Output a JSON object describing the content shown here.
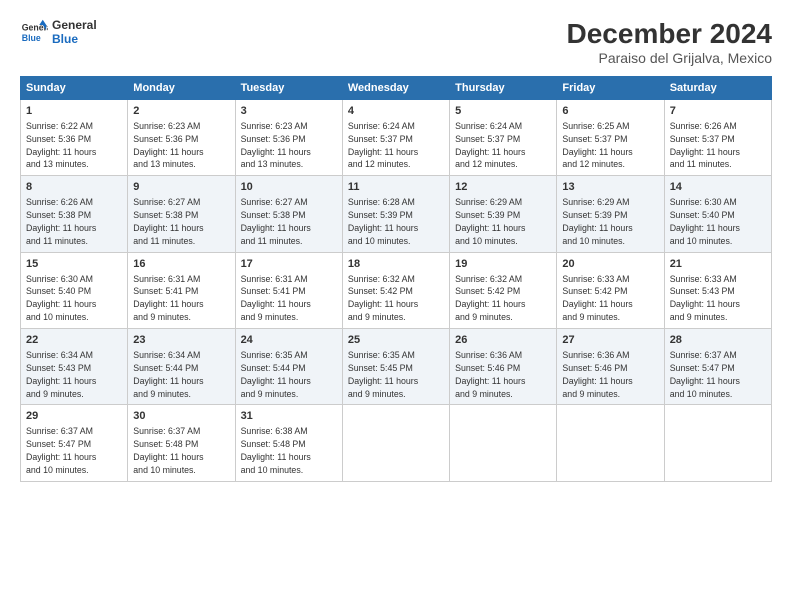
{
  "logo": {
    "line1": "General",
    "line2": "Blue"
  },
  "title": "December 2024",
  "subtitle": "Paraiso del Grijalva, Mexico",
  "days_of_week": [
    "Sunday",
    "Monday",
    "Tuesday",
    "Wednesday",
    "Thursday",
    "Friday",
    "Saturday"
  ],
  "weeks": [
    [
      {
        "day": "1",
        "sunrise": "6:22 AM",
        "sunset": "5:36 PM",
        "daylight": "11 hours and 13 minutes."
      },
      {
        "day": "2",
        "sunrise": "6:23 AM",
        "sunset": "5:36 PM",
        "daylight": "11 hours and 13 minutes."
      },
      {
        "day": "3",
        "sunrise": "6:23 AM",
        "sunset": "5:36 PM",
        "daylight": "11 hours and 13 minutes."
      },
      {
        "day": "4",
        "sunrise": "6:24 AM",
        "sunset": "5:37 PM",
        "daylight": "11 hours and 12 minutes."
      },
      {
        "day": "5",
        "sunrise": "6:24 AM",
        "sunset": "5:37 PM",
        "daylight": "11 hours and 12 minutes."
      },
      {
        "day": "6",
        "sunrise": "6:25 AM",
        "sunset": "5:37 PM",
        "daylight": "11 hours and 12 minutes."
      },
      {
        "day": "7",
        "sunrise": "6:26 AM",
        "sunset": "5:37 PM",
        "daylight": "11 hours and 11 minutes."
      }
    ],
    [
      {
        "day": "8",
        "sunrise": "6:26 AM",
        "sunset": "5:38 PM",
        "daylight": "11 hours and 11 minutes."
      },
      {
        "day": "9",
        "sunrise": "6:27 AM",
        "sunset": "5:38 PM",
        "daylight": "11 hours and 11 minutes."
      },
      {
        "day": "10",
        "sunrise": "6:27 AM",
        "sunset": "5:38 PM",
        "daylight": "11 hours and 11 minutes."
      },
      {
        "day": "11",
        "sunrise": "6:28 AM",
        "sunset": "5:39 PM",
        "daylight": "11 hours and 10 minutes."
      },
      {
        "day": "12",
        "sunrise": "6:29 AM",
        "sunset": "5:39 PM",
        "daylight": "11 hours and 10 minutes."
      },
      {
        "day": "13",
        "sunrise": "6:29 AM",
        "sunset": "5:39 PM",
        "daylight": "11 hours and 10 minutes."
      },
      {
        "day": "14",
        "sunrise": "6:30 AM",
        "sunset": "5:40 PM",
        "daylight": "11 hours and 10 minutes."
      }
    ],
    [
      {
        "day": "15",
        "sunrise": "6:30 AM",
        "sunset": "5:40 PM",
        "daylight": "11 hours and 10 minutes."
      },
      {
        "day": "16",
        "sunrise": "6:31 AM",
        "sunset": "5:41 PM",
        "daylight": "11 hours and 9 minutes."
      },
      {
        "day": "17",
        "sunrise": "6:31 AM",
        "sunset": "5:41 PM",
        "daylight": "11 hours and 9 minutes."
      },
      {
        "day": "18",
        "sunrise": "6:32 AM",
        "sunset": "5:42 PM",
        "daylight": "11 hours and 9 minutes."
      },
      {
        "day": "19",
        "sunrise": "6:32 AM",
        "sunset": "5:42 PM",
        "daylight": "11 hours and 9 minutes."
      },
      {
        "day": "20",
        "sunrise": "6:33 AM",
        "sunset": "5:42 PM",
        "daylight": "11 hours and 9 minutes."
      },
      {
        "day": "21",
        "sunrise": "6:33 AM",
        "sunset": "5:43 PM",
        "daylight": "11 hours and 9 minutes."
      }
    ],
    [
      {
        "day": "22",
        "sunrise": "6:34 AM",
        "sunset": "5:43 PM",
        "daylight": "11 hours and 9 minutes."
      },
      {
        "day": "23",
        "sunrise": "6:34 AM",
        "sunset": "5:44 PM",
        "daylight": "11 hours and 9 minutes."
      },
      {
        "day": "24",
        "sunrise": "6:35 AM",
        "sunset": "5:44 PM",
        "daylight": "11 hours and 9 minutes."
      },
      {
        "day": "25",
        "sunrise": "6:35 AM",
        "sunset": "5:45 PM",
        "daylight": "11 hours and 9 minutes."
      },
      {
        "day": "26",
        "sunrise": "6:36 AM",
        "sunset": "5:46 PM",
        "daylight": "11 hours and 9 minutes."
      },
      {
        "day": "27",
        "sunrise": "6:36 AM",
        "sunset": "5:46 PM",
        "daylight": "11 hours and 9 minutes."
      },
      {
        "day": "28",
        "sunrise": "6:37 AM",
        "sunset": "5:47 PM",
        "daylight": "11 hours and 10 minutes."
      }
    ],
    [
      {
        "day": "29",
        "sunrise": "6:37 AM",
        "sunset": "5:47 PM",
        "daylight": "11 hours and 10 minutes."
      },
      {
        "day": "30",
        "sunrise": "6:37 AM",
        "sunset": "5:48 PM",
        "daylight": "11 hours and 10 minutes."
      },
      {
        "day": "31",
        "sunrise": "6:38 AM",
        "sunset": "5:48 PM",
        "daylight": "11 hours and 10 minutes."
      },
      null,
      null,
      null,
      null
    ]
  ],
  "labels": {
    "sunrise": "Sunrise:",
    "sunset": "Sunset:",
    "daylight": "Daylight:"
  }
}
